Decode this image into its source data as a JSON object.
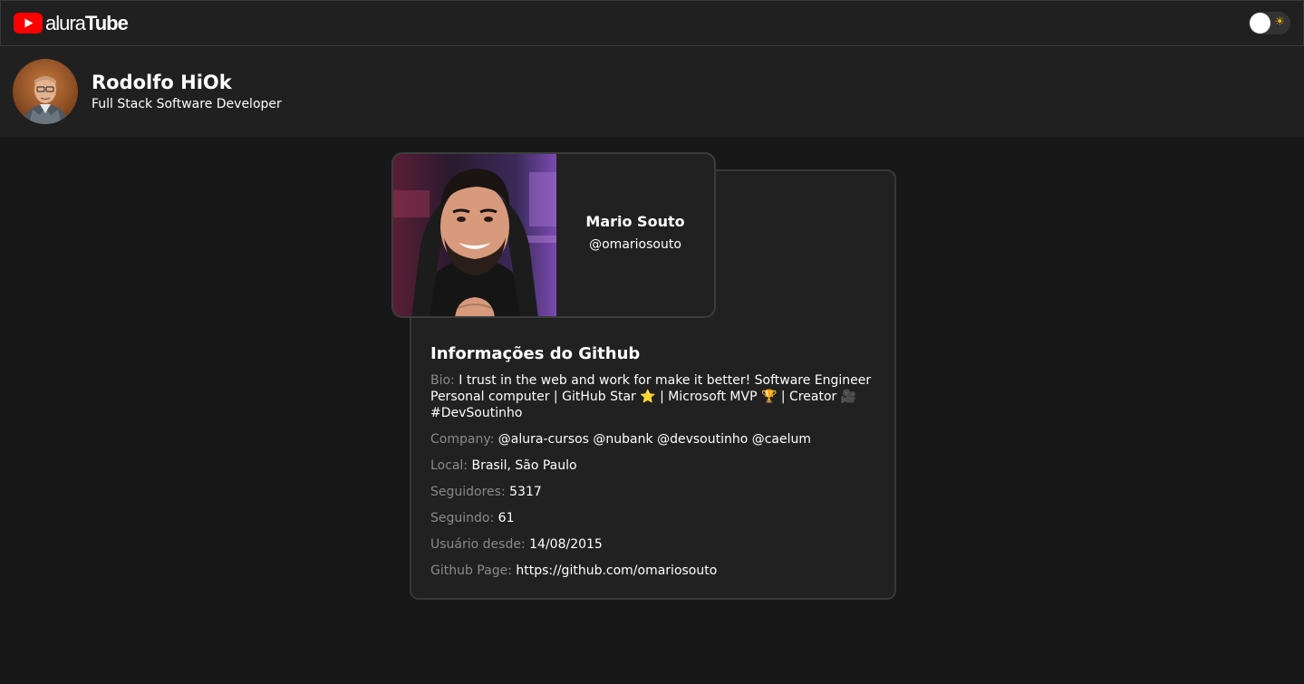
{
  "header": {
    "logo": {
      "prefix": "alura",
      "suffix": "Tube",
      "brand_color": "#ff0000"
    },
    "theme_toggle": {
      "icon": "sun-icon",
      "state": "dark"
    }
  },
  "profile": {
    "name": "Rodolfo HiOk",
    "role": "Full Stack Software Developer"
  },
  "user_card": {
    "name": "Mario Souto",
    "login": "@omariosouto"
  },
  "github_info": {
    "title": "Informações do Github",
    "bio_label": "Bio:",
    "bio_value": "I trust in the web and work for make it better!  Software Engineer Personal computer | GitHub Star ⭐ | Microsoft MVP 🏆 | Creator 🎥 #DevSoutinho",
    "company_label": "Company:",
    "company_value": "@alura-cursos @nubank @devsoutinho @caelum",
    "local_label": "Local:",
    "local_value": "Brasil, São Paulo",
    "followers_label": "Seguidores:",
    "followers_value": "5317",
    "following_label": "Seguindo:",
    "following_value": "61",
    "since_label": "Usuário desde:",
    "since_value": "14/08/2015",
    "page_label": "Github Page:",
    "page_value": "https://github.com/omariosouto"
  }
}
